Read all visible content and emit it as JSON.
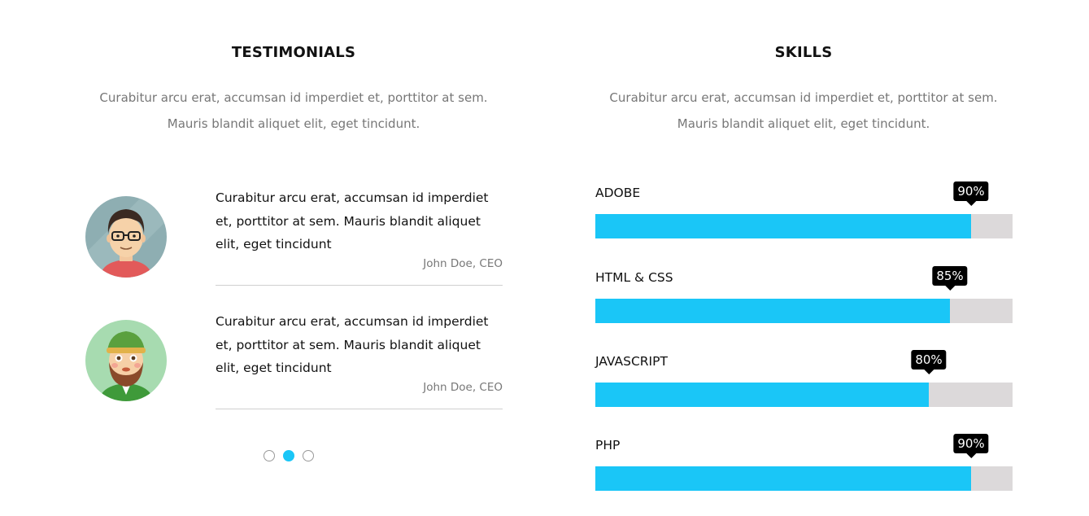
{
  "testimonials_section": {
    "title": "TESTIMONIALS",
    "lead_line1": "Curabitur arcu erat, accumsan id imperdiet et, porttitor at sem.",
    "lead_line2": "Mauris blandit aliquet elit, eget tincidunt.",
    "items": [
      {
        "text": "Curabitur arcu erat, accumsan id imperdiet et, porttitor at sem. Mauris blandit aliquet elit, eget tincidunt",
        "author": "John Doe, CEO",
        "avatar_icon": "man-glasses-avatar-icon"
      },
      {
        "text": "Curabitur arcu erat, accumsan id imperdiet et, porttitor at sem. Mauris blandit aliquet elit, eget tincidunt",
        "author": "John Doe, CEO",
        "avatar_icon": "bearded-man-hat-avatar-icon"
      }
    ],
    "pagination": {
      "total": 3,
      "active_index": 1
    }
  },
  "skills_section": {
    "title": "SKILLS",
    "lead_line1": "Curabitur arcu erat, accumsan id imperdiet et, porttitor at sem.",
    "lead_line2": "Mauris blandit aliquet elit, eget tincidunt.",
    "skills": [
      {
        "name": "ADOBE",
        "percent_label": "90%",
        "level": 0.9
      },
      {
        "name": "HTML & CSS",
        "percent_label": "85%",
        "level": 0.85
      },
      {
        "name": "JAVASCRIPT",
        "percent_label": "80%",
        "level": 0.8
      },
      {
        "name": "PHP",
        "percent_label": "90%",
        "level": 0.9
      }
    ]
  },
  "colors": {
    "accent": "#1ac6f7",
    "track": "#dcd9da",
    "muted_text": "#777777",
    "tooltip": "#000000"
  }
}
